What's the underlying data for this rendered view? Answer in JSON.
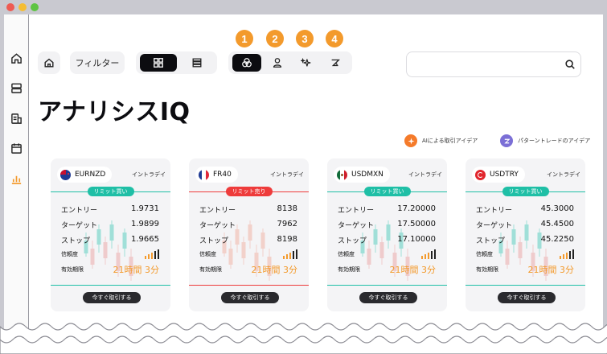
{
  "app": {
    "page_title": "アナリシスIQ"
  },
  "toolbar": {
    "filter_label": "フィルター",
    "badges": [
      "1",
      "2",
      "3",
      "4"
    ]
  },
  "legend": {
    "ai_ideas": "AIによる取引アイデア",
    "pattern_ideas": "パターントレードのアイデア"
  },
  "colors": {
    "accent_orange": "#f39a2c",
    "buy_teal": "#1fbfa6",
    "sell_red": "#ee3b3b",
    "ai_orange": "#f57b2a",
    "pattern_purple": "#7b6fd6"
  },
  "labels": {
    "entry": "エントリー",
    "target": "ターゲット",
    "stop": "ストップ",
    "confidence": "信頼度",
    "expiry": "有効期限",
    "trade_now": "今すぐ取引する",
    "intraday": "イントラデイ"
  },
  "cards": [
    {
      "pair": "EURNZD",
      "order": "リミット買い",
      "type": "buy",
      "entry": "1.9731",
      "target": "1.9899",
      "stop": "1.9665",
      "expiry_value": "21時間 3分",
      "flag": "nz"
    },
    {
      "pair": "FR40",
      "order": "リミット売り",
      "type": "sell",
      "entry": "8138",
      "target": "7962",
      "stop": "8198",
      "expiry_value": "21時間 3分",
      "flag": "fr"
    },
    {
      "pair": "USDMXN",
      "order": "リミット買い",
      "type": "buy",
      "entry": "17.20000",
      "target": "17.50000",
      "stop": "17.10000",
      "expiry_value": "21時間 3分",
      "flag": "mx"
    },
    {
      "pair": "USDTRY",
      "order": "リミット買い",
      "type": "buy",
      "entry": "45.3000",
      "target": "45.4500",
      "stop": "45.2250",
      "expiry_value": "21時間 3分",
      "flag": "tr"
    }
  ]
}
